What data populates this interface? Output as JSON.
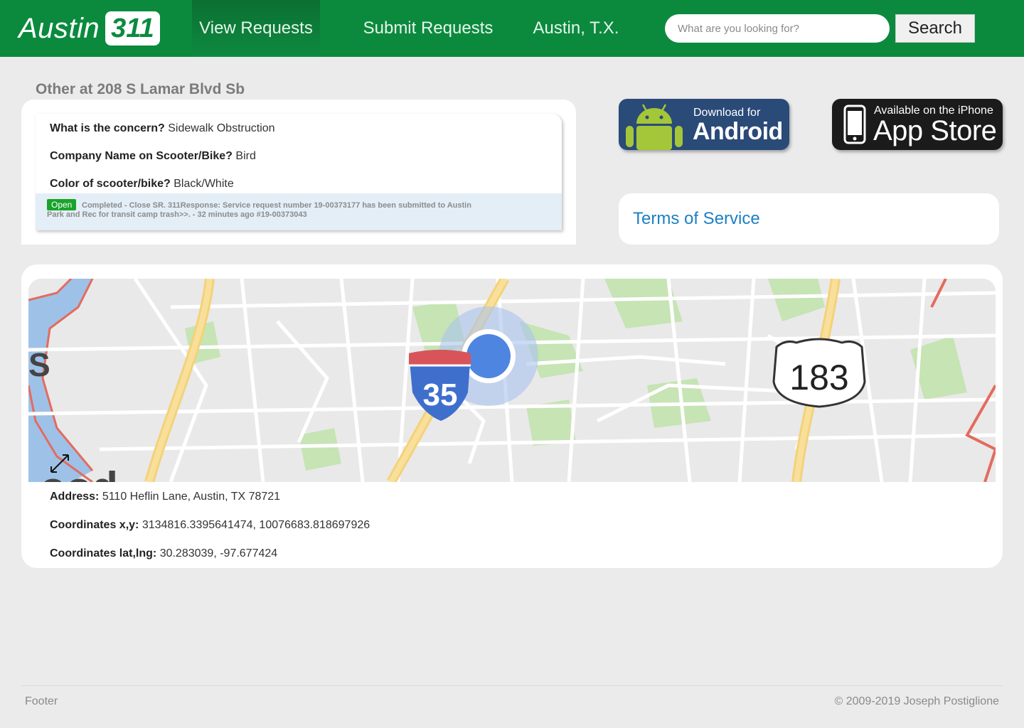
{
  "header": {
    "logo_word": "Austin",
    "logo_number": "311",
    "nav": [
      {
        "label": "View Requests",
        "active": true
      },
      {
        "label": "Submit Requests",
        "active": false
      },
      {
        "label": "Austin, T.X.",
        "active": false
      }
    ],
    "search_placeholder": "What are you looking for?",
    "search_button": "Search"
  },
  "request": {
    "title": "Other at 208 S Lamar Blvd Sb",
    "fields": [
      {
        "label": "What is the concern?",
        "value": "Sidewalk Obstruction"
      },
      {
        "label": "Company Name on Scooter/Bike?",
        "value": "Bird"
      },
      {
        "label": "Color of scooter/bike?",
        "value": "Black/White"
      }
    ],
    "status_badge": "Open",
    "status_text": "Completed - Close SR. 311Response: Service request number 19-00373177 has been submitted to Austin Park and Rec for transit camp trash>>. - 32 minutes ago #19-00373043"
  },
  "stores": {
    "android": {
      "small": "Download for",
      "big": "Android"
    },
    "apple": {
      "small": "Available on the iPhone",
      "big": "App Store"
    }
  },
  "terms_link": "Terms of Service",
  "map": {
    "interstate_shield": "35",
    "us_shield": "183",
    "label_fragment_left": "S",
    "label_fragment_bottom": "ood"
  },
  "location": [
    {
      "label": "Address:",
      "value": "5110 Heflin Lane, Austin, TX 78721"
    },
    {
      "label": "Coordinates x,y:",
      "value": "3134816.3395641474, 10076683.818697926"
    },
    {
      "label": "Coordinates lat,lng:",
      "value": "30.283039, -97.677424"
    }
  ],
  "footer": {
    "left": "Footer",
    "right": "© 2009-2019 Joseph Postiglione"
  },
  "colors": {
    "header_green": "#0b8a3e",
    "link_blue": "#1d7fc4",
    "open_badge": "#1aa32a"
  }
}
